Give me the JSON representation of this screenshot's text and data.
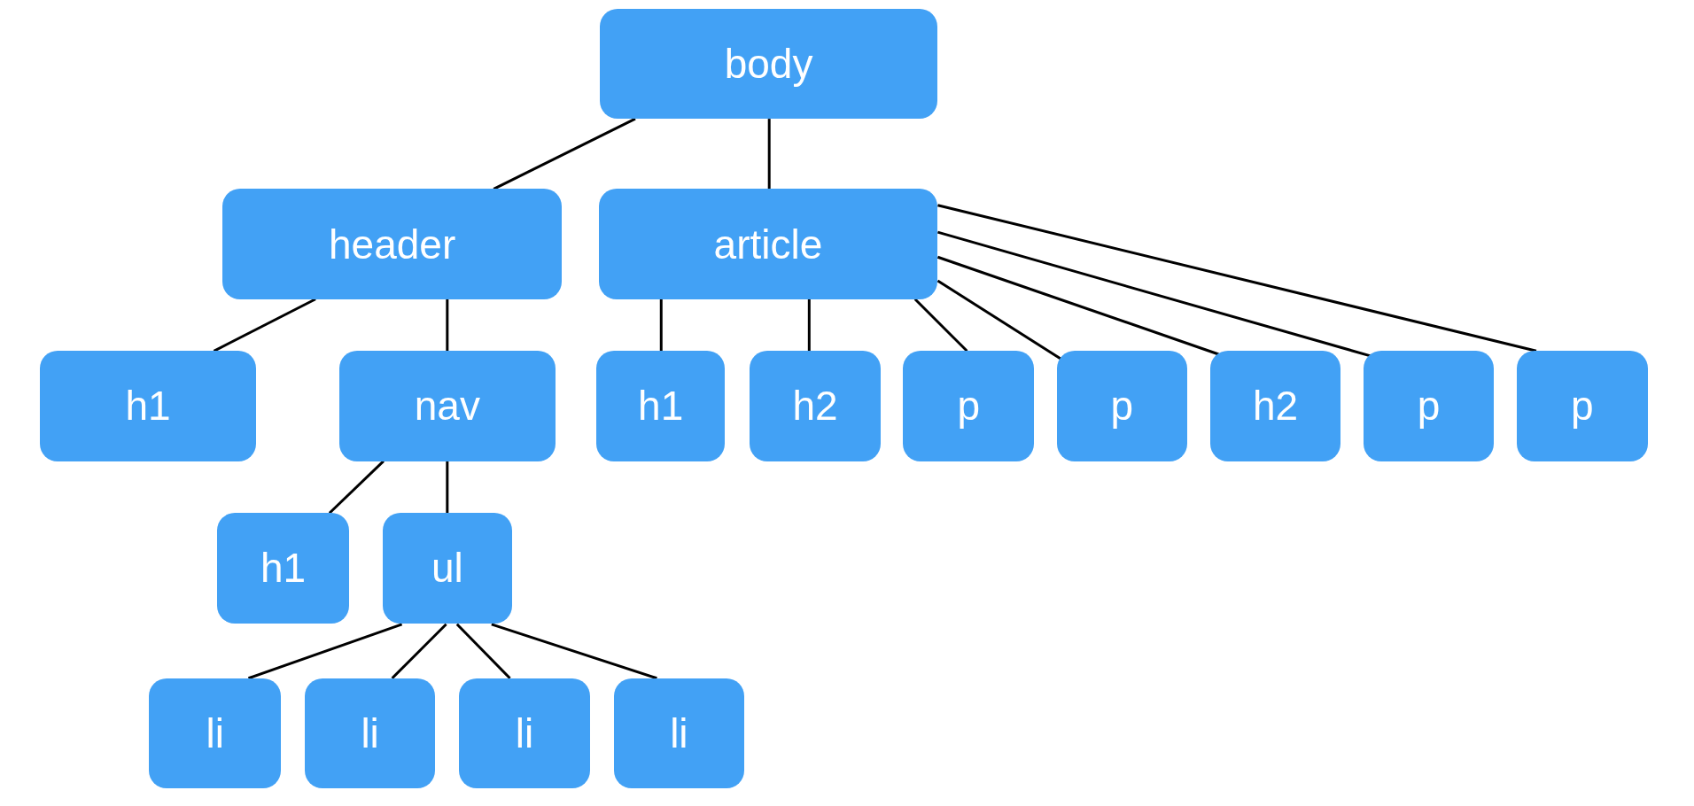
{
  "tree": {
    "label": "body",
    "children": [
      {
        "label": "header",
        "children": [
          {
            "label": "h1"
          },
          {
            "label": "nav",
            "children": [
              {
                "label": "h1"
              },
              {
                "label": "ul",
                "children": [
                  {
                    "label": "li"
                  },
                  {
                    "label": "li"
                  },
                  {
                    "label": "li"
                  },
                  {
                    "label": "li"
                  }
                ]
              }
            ]
          }
        ]
      },
      {
        "label": "article",
        "children": [
          {
            "label": "h1"
          },
          {
            "label": "h2"
          },
          {
            "label": "p"
          },
          {
            "label": "p"
          },
          {
            "label": "h2"
          },
          {
            "label": "p"
          },
          {
            "label": "p"
          }
        ]
      }
    ]
  }
}
